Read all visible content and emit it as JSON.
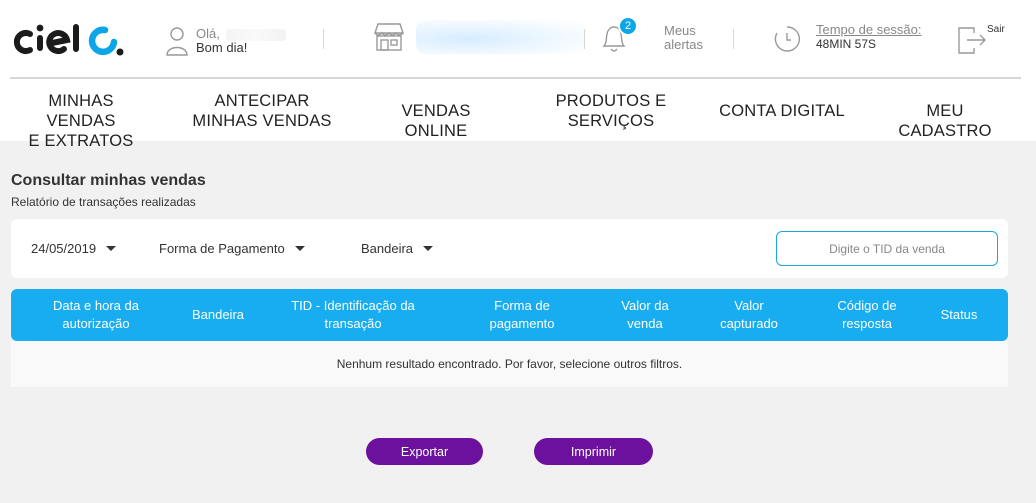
{
  "header": {
    "logo_text": "cielo",
    "user": {
      "greeting": "Olá,",
      "salutation": "Bom dia!"
    },
    "alerts": {
      "count": "2",
      "line1": "Meus",
      "line2": "alertas"
    },
    "session": {
      "label": "Tempo de sessão:",
      "time": "48MIN 57S"
    },
    "exit_label": "Sair"
  },
  "nav": {
    "items": [
      {
        "label": "MINHAS VENDAS\nE EXTRATOS"
      },
      {
        "label": "ANTECIPAR\nMINHAS VENDAS"
      },
      {
        "label": "VENDAS ONLINE"
      },
      {
        "label": "PRODUTOS E\nSERVIÇOS"
      },
      {
        "label": "CONTA DIGITAL"
      },
      {
        "label": "MEU CADASTRO"
      }
    ]
  },
  "page": {
    "title": "Consultar minhas vendas",
    "subtitle": "Relatório de transações realizadas"
  },
  "filters": {
    "date": "24/05/2019",
    "payment": "Forma de Pagamento",
    "brand": "Bandeira",
    "tid_placeholder": "Digite o TID da venda"
  },
  "table": {
    "columns": [
      "Data e hora da\nautorização",
      "Bandeira",
      "TID - Identificação da\ntransação",
      "Forma de\npagamento",
      "Valor da\nvenda",
      "Valor\ncapturado",
      "Código de\nresposta",
      "Status"
    ],
    "empty_message": "Nenhum resultado encontrado. Por favor, selecione outros filtros."
  },
  "actions": {
    "export": "Exportar",
    "print": "Imprimir"
  },
  "colors": {
    "accent": "#18adf0",
    "button": "#6c119e",
    "logo_blue": "#0aa6e8"
  }
}
